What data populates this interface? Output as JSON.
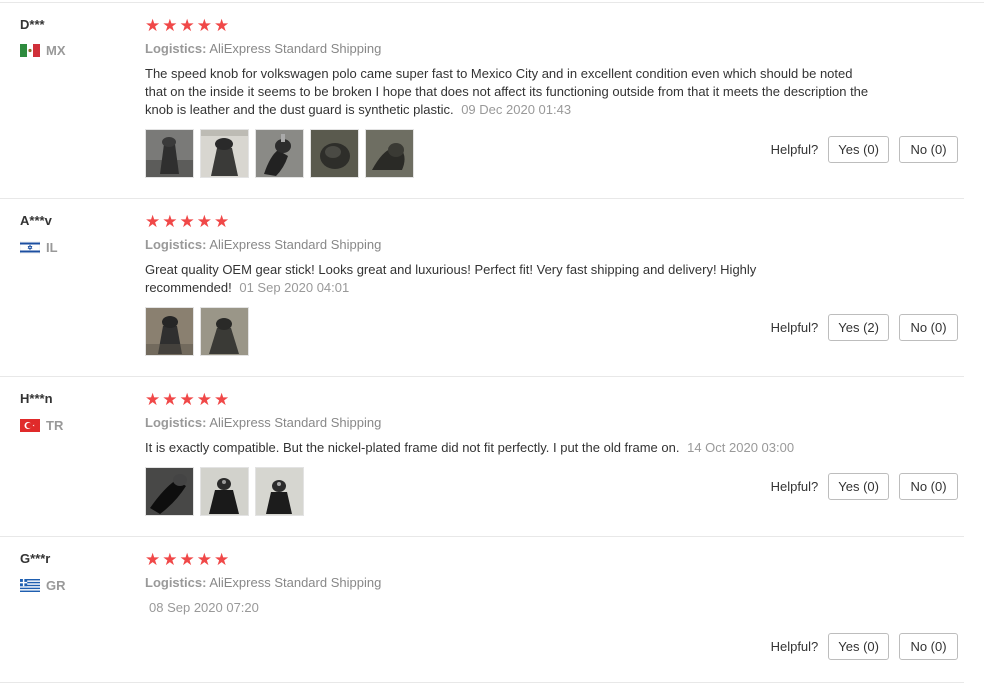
{
  "helpful_label": "Helpful?",
  "logistics_label": "Logistics:",
  "star_glyph": "★",
  "reviews": [
    {
      "user": "D***",
      "country_code": "MX",
      "rating": 5,
      "logistics": "AliExpress Standard Shipping",
      "text": "The speed knob for volkswagen polo came super fast to Mexico City and in excellent condition even which should be noted that on the inside it seems to be broken I hope that does not affect its functioning outside from that it meets the description the knob is leather and the dust guard is synthetic plastic.",
      "date": "09 Dec 2020 01:43",
      "photo_count": 5,
      "yes_label": "Yes (0)",
      "no_label": "No (0)"
    },
    {
      "user": "A***v",
      "country_code": "IL",
      "rating": 5,
      "logistics": "AliExpress Standard Shipping",
      "text": "Great quality OEM gear stick! Looks great and luxurious! Perfect fit! Very fast shipping and delivery! Highly recommended!",
      "date": "01 Sep 2020 04:01",
      "photo_count": 2,
      "yes_label": "Yes (2)",
      "no_label": "No (0)"
    },
    {
      "user": "H***n",
      "country_code": "TR",
      "rating": 5,
      "logistics": "AliExpress Standard Shipping",
      "text": "It is exactly compatible. But the nickel-plated frame did not fit perfectly. I put the old frame on.",
      "date": "14 Oct 2020 03:00",
      "photo_count": 3,
      "yes_label": "Yes (0)",
      "no_label": "No (0)"
    },
    {
      "user": "G***r",
      "country_code": "GR",
      "rating": 5,
      "logistics": "AliExpress Standard Shipping",
      "text": "",
      "date": "08 Sep 2020 07:20",
      "photo_count": 0,
      "yes_label": "Yes (0)",
      "no_label": "No (0)"
    }
  ]
}
